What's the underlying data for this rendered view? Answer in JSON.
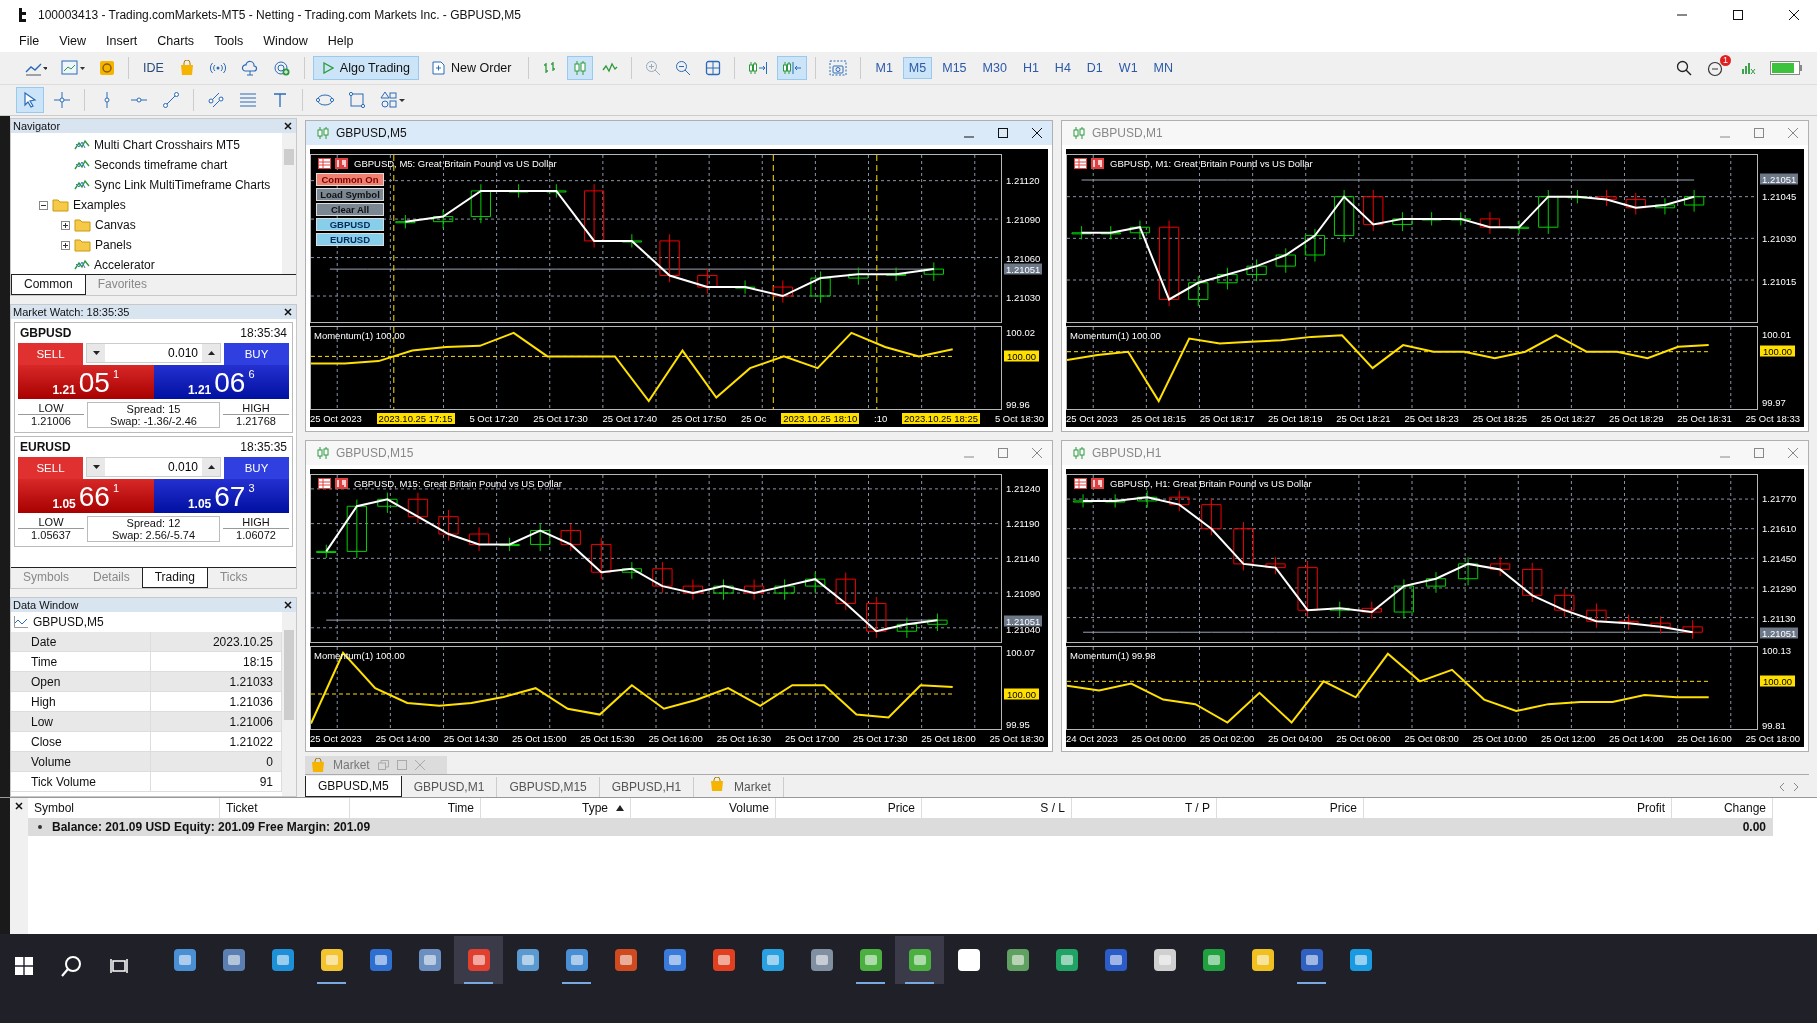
{
  "window": {
    "title": "100003413 - Trading.comMarkets-MT5 - Netting - Trading.com Markets Inc. - GBPUSD,M5"
  },
  "menu": [
    "File",
    "View",
    "Insert",
    "Charts",
    "Tools",
    "Window",
    "Help"
  ],
  "toolbar": {
    "ide": "IDE",
    "algo_trading": {
      "label": "Algo Trading",
      "selected": true
    },
    "new_order": "New Order",
    "chart_modes": [
      {
        "selected": false
      },
      {
        "selected": true
      },
      {
        "selected": false
      }
    ],
    "chart_shift": [
      {
        "selected": false
      },
      {
        "selected": true
      }
    ],
    "timeframes": [
      {
        "label": "M1",
        "selected": false
      },
      {
        "label": "M5",
        "selected": true
      },
      {
        "label": "M15",
        "selected": false
      },
      {
        "label": "M30",
        "selected": false
      },
      {
        "label": "H1",
        "selected": false
      },
      {
        "label": "H4",
        "selected": false
      },
      {
        "label": "D1",
        "selected": false
      },
      {
        "label": "W1",
        "selected": false
      },
      {
        "label": "MN",
        "selected": false
      }
    ],
    "notifications": "1",
    "drawing_tools": [
      {
        "selected": true
      },
      {
        "selected": false
      },
      {
        "selected": false
      },
      {
        "selected": false
      },
      {
        "selected": false
      },
      {
        "selected": false
      },
      {
        "selected": false
      },
      {
        "selected": false
      },
      {
        "selected": false
      },
      {
        "selected": false
      },
      {
        "selected": false
      }
    ]
  },
  "navigator": {
    "title": "Navigator",
    "items": [
      {
        "label": "Multi Chart Crosshairs MT5",
        "kind": "program"
      },
      {
        "label": "Seconds timeframe chart",
        "kind": "program"
      },
      {
        "label": "Sync Link MultiTimeframe Charts",
        "kind": "program"
      },
      {
        "label": "Examples",
        "kind": "folder",
        "expanded": true,
        "children": [
          {
            "label": "Canvas",
            "kind": "folder",
            "expanded": false
          },
          {
            "label": "Panels",
            "kind": "folder",
            "expanded": false
          },
          {
            "label": "Accelerator",
            "kind": "program"
          }
        ]
      }
    ],
    "tabs": [
      {
        "label": "Common",
        "selected": true
      },
      {
        "label": "Favorites",
        "selected": false
      }
    ]
  },
  "market_watch": {
    "title": "Market Watch: 18:35:35",
    "symbols": [
      {
        "symbol": "GBPUSD",
        "time": "18:35:34",
        "sell": "SELL",
        "buy": "BUY",
        "volume": "0.010",
        "bid": {
          "prefix": "1.21",
          "pips": "05",
          "point": "1"
        },
        "ask": {
          "prefix": "1.21",
          "pips": "06",
          "point": "6"
        },
        "low_label": "LOW",
        "low": "1.21006",
        "spread": "Spread: 15",
        "swap": "Swap: -1.36/-2.46",
        "high_label": "HIGH",
        "high": "1.21768"
      },
      {
        "symbol": "EURUSD",
        "time": "18:35:35",
        "sell": "SELL",
        "buy": "BUY",
        "volume": "0.010",
        "bid": {
          "prefix": "1.05",
          "pips": "66",
          "point": "1"
        },
        "ask": {
          "prefix": "1.05",
          "pips": "67",
          "point": "3"
        },
        "low_label": "LOW",
        "low": "1.05637",
        "spread": "Spread: 12",
        "swap": "Swap: 2.56/-5.74",
        "high_label": "HIGH",
        "high": "1.06072"
      }
    ],
    "tabs": [
      {
        "label": "Symbols",
        "selected": false
      },
      {
        "label": "Details",
        "selected": false
      },
      {
        "label": "Trading",
        "selected": true
      },
      {
        "label": "Ticks",
        "selected": false
      }
    ]
  },
  "data_window": {
    "title": "Data Window",
    "symbol": "GBPUSD,M5",
    "rows": [
      {
        "label": "Date",
        "value": "2023.10.25"
      },
      {
        "label": "Time",
        "value": "18:15"
      },
      {
        "label": "Open",
        "value": "1.21033"
      },
      {
        "label": "High",
        "value": "1.21036"
      },
      {
        "label": "Low",
        "value": "1.21006"
      },
      {
        "label": "Close",
        "value": "1.21022"
      },
      {
        "label": "Volume",
        "value": "0"
      },
      {
        "label": "Tick Volume",
        "value": "91"
      }
    ]
  },
  "charts": [
    {
      "title": "GBPUSD,M5",
      "active": true,
      "current_price": "1.21051",
      "indicator_level": "100.00",
      "price_chart": {
        "chart_data": {
          "type": "line",
          "title": "GBPUSD, M5:  Great Britain Pound vs US Dollar",
          "ylim": [
            1.2101,
            1.2114
          ],
          "grid": true,
          "yticks": [
            {
              "value": 1.2112,
              "label": "1.21120"
            },
            {
              "value": 1.2109,
              "label": "1.21090"
            },
            {
              "value": 1.2106,
              "label": "1.21060"
            },
            {
              "value": 1.2103,
              "label": "1.21030"
            }
          ],
          "series": [
            {
              "color": "#ffffff",
              "values": [
                null,
                null,
                1.21088,
                1.21092,
                1.21112,
                1.21112,
                1.21112,
                1.21073,
                1.21073,
                1.21046,
                1.21037,
                1.21037,
                1.2103,
                1.21044,
                1.21047,
                1.21047,
                1.21051
              ]
            },
            {
              "color": "#9aa3b5",
              "values": [
                1.21051,
                1.21051,
                1.21051,
                1.21051,
                1.21051,
                1.21051,
                1.21051,
                1.21051,
                1.21051,
                1.21051,
                1.21051,
                1.21051,
                1.21051,
                1.21051,
                1.21051,
                1.21051,
                1.21051
              ]
            }
          ]
        }
      },
      "momentum_chart": {
        "chart_data": {
          "type": "line",
          "title": "Momentum(1) 100.00",
          "ylim": [
            99.955,
            100.025
          ],
          "grid": true,
          "yticks": [
            {
              "value": 100.02,
              "label": "100.02"
            },
            {
              "value": 99.96,
              "label": "99.96"
            }
          ],
          "series": [
            {
              "color": "#ffe000",
              "values": [
                99.994,
                99.994,
                99.996,
                100.005,
                100.008,
                100.009,
                100.02,
                100.0,
                100.0,
                100.0,
                99.962,
                100.005,
                99.965,
                99.99,
                100.0,
                99.99,
                100.02,
                100.008,
                100.0,
                100.006
              ]
            },
            {
              "color": "#ffe000",
              "line_style": "dashed",
              "values": [
                100.0,
                100.0,
                100.0,
                100.0,
                100.0,
                100.0,
                100.0,
                100.0,
                100.0,
                100.0,
                100.0,
                100.0,
                100.0,
                100.0,
                100.0,
                100.0,
                100.0,
                100.0,
                100.0,
                100.0
              ]
            }
          ]
        }
      },
      "panel_buttons": [
        {
          "label": "Common On",
          "kind": "toggle"
        },
        {
          "label": "Load Symbol",
          "kind": "action"
        },
        {
          "label": "Clear All",
          "kind": "action"
        },
        {
          "label": "GBPUSD",
          "kind": "symbol"
        },
        {
          "label": "EURUSD",
          "kind": "symbol"
        }
      ],
      "time_labels": [
        {
          "text": "25 Oct 2023",
          "kind": "time"
        },
        {
          "text": "2023.10.25 17:15",
          "kind": "marker"
        },
        {
          "text": "5 Oct 17:20",
          "kind": "time"
        },
        {
          "text": "25 Oct 17:30",
          "kind": "time"
        },
        {
          "text": "25 Oct 17:40",
          "kind": "time"
        },
        {
          "text": "25 Oct 17:50",
          "kind": "time"
        },
        {
          "text": "25 Oc",
          "kind": "time"
        },
        {
          "text": "2023.10.25 18:10",
          "kind": "marker"
        },
        {
          "text": ":10",
          "kind": "time"
        },
        {
          "text": "2023.10.25 18:25",
          "kind": "marker"
        },
        {
          "text": "5 Oct 18:30",
          "kind": "time"
        }
      ]
    },
    {
      "title": "GBPUSD,M1",
      "active": false,
      "current_price": "1.21051",
      "indicator_level": "100.00",
      "price_chart": {
        "chart_data": {
          "type": "line",
          "title": "GBPUSD, M1:  Great Britain Pound vs US Dollar",
          "ylim": [
            1.21,
            1.2106
          ],
          "grid": true,
          "yticks": [
            {
              "value": 1.21045,
              "label": "1.21045"
            },
            {
              "value": 1.2103,
              "label": "1.21030"
            },
            {
              "value": 1.21015,
              "label": "1.21015"
            }
          ],
          "series": [
            {
              "color": "#ffffff",
              "values": [
                1.21032,
                1.21032,
                1.21034,
                1.21008,
                1.21014,
                1.21017,
                1.2102,
                1.21024,
                1.21031,
                1.21045,
                1.21035,
                1.21037,
                1.21037,
                1.21037,
                1.21034,
                1.21034,
                1.21045,
                1.21045,
                1.21044,
                1.21041,
                1.21042,
                1.21045
              ]
            },
            {
              "color": "#9aa3b5",
              "values": [
                1.21051,
                1.21051,
                1.21051,
                1.21051,
                1.21051,
                1.21051,
                1.21051,
                1.21051,
                1.21051,
                1.21051,
                1.21051,
                1.21051,
                1.21051,
                1.21051,
                1.21051,
                1.21051,
                1.21051,
                1.21051,
                1.21051,
                1.21051,
                1.21051,
                1.21051
              ]
            }
          ]
        }
      },
      "momentum_chart": {
        "chart_data": {
          "type": "line",
          "title": "Momentum(1) 100.00",
          "ylim": [
            99.965,
            100.015
          ],
          "grid": true,
          "yticks": [
            {
              "value": 100.01,
              "label": "100.01"
            },
            {
              "value": 99.97,
              "label": "99.97"
            }
          ],
          "series": [
            {
              "color": "#ffe000",
              "values": [
                99.995,
                99.998,
                100.0,
                99.97,
                100.008,
                100.005,
                100.006,
                100.007,
                100.009,
                100.01,
                99.99,
                100.004,
                100.0,
                100.0,
                99.996,
                100.0,
                100.01,
                100.0,
                100.0,
                99.996,
                100.003,
                100.004
              ]
            },
            {
              "color": "#ffe000",
              "line_style": "dashed",
              "values": [
                100.0,
                100.0,
                100.0,
                100.0,
                100.0,
                100.0,
                100.0,
                100.0,
                100.0,
                100.0,
                100.0,
                100.0,
                100.0,
                100.0,
                100.0,
                100.0,
                100.0,
                100.0,
                100.0,
                100.0,
                100.0,
                100.0
              ]
            }
          ]
        }
      },
      "time_labels": [
        {
          "text": "25 Oct 2023",
          "kind": "time"
        },
        {
          "text": "25 Oct 18:15",
          "kind": "time"
        },
        {
          "text": "25 Oct 18:17",
          "kind": "time"
        },
        {
          "text": "25 Oct 18:19",
          "kind": "time"
        },
        {
          "text": "25 Oct 18:21",
          "kind": "time"
        },
        {
          "text": "25 Oct 18:23",
          "kind": "time"
        },
        {
          "text": "25 Oct 18:25",
          "kind": "time"
        },
        {
          "text": "25 Oct 18:27",
          "kind": "time"
        },
        {
          "text": "25 Oct 18:29",
          "kind": "time"
        },
        {
          "text": "25 Oct 18:31",
          "kind": "time"
        },
        {
          "text": "25 Oct 18:33",
          "kind": "time"
        }
      ]
    },
    {
      "title": "GBPUSD,M15",
      "active": false,
      "current_price": "1.21051",
      "indicator_level": "100.00",
      "price_chart": {
        "chart_data": {
          "type": "line",
          "title": "GBPUSD, M15:  Great Britain Pound vs US Dollar",
          "ylim": [
            1.2102,
            1.2126
          ],
          "grid": true,
          "yticks": [
            {
              "value": 1.2124,
              "label": "1.21240"
            },
            {
              "value": 1.2119,
              "label": "1.21190"
            },
            {
              "value": 1.2114,
              "label": "1.21140"
            },
            {
              "value": 1.2109,
              "label": "1.21090"
            },
            {
              "value": 1.2104,
              "label": "1.21040"
            }
          ],
          "series": [
            {
              "color": "#ffffff",
              "values": [
                1.2115,
                1.21215,
                1.21225,
                1.212,
                1.21175,
                1.2116,
                1.2116,
                1.2118,
                1.2116,
                1.2112,
                1.21125,
                1.211,
                1.2109,
                1.211,
                1.2109,
                1.211,
                1.2111,
                1.21075,
                1.21035,
                1.21045,
                1.21051
              ]
            },
            {
              "color": "#9aa3b5",
              "values": [
                1.21051,
                1.21051,
                1.21051,
                1.21051,
                1.21051,
                1.21051,
                1.21051,
                1.21051,
                1.21051,
                1.21051,
                1.21051,
                1.21051,
                1.21051,
                1.21051,
                1.21051,
                1.21051,
                1.21051,
                1.21051,
                1.21051,
                1.21051,
                1.21051
              ]
            }
          ]
        }
      },
      "momentum_chart": {
        "chart_data": {
          "type": "line",
          "title": "Momentum(1) 100.00",
          "ylim": [
            99.94,
            100.08
          ],
          "grid": true,
          "yticks": [
            {
              "value": 100.07,
              "label": "100.07"
            },
            {
              "value": 99.95,
              "label": "99.95"
            }
          ],
          "series": [
            {
              "color": "#ffe000",
              "values": [
                99.95,
                100.07,
                100.01,
                99.985,
                99.98,
                99.985,
                99.995,
                100.01,
                99.975,
                99.965,
                100.015,
                99.975,
                99.99,
                100.01,
                99.98,
                100.015,
                100.015,
                99.965,
                99.96,
                100.015,
                100.012
              ]
            },
            {
              "color": "#ffe000",
              "line_style": "dashed",
              "values": [
                100.0,
                100.0,
                100.0,
                100.0,
                100.0,
                100.0,
                100.0,
                100.0,
                100.0,
                100.0,
                100.0,
                100.0,
                100.0,
                100.0,
                100.0,
                100.0,
                100.0,
                100.0,
                100.0,
                100.0,
                100.0
              ]
            }
          ]
        }
      },
      "time_labels": [
        {
          "text": "25 Oct 2023",
          "kind": "time"
        },
        {
          "text": "25 Oct 14:00",
          "kind": "time"
        },
        {
          "text": "25 Oct 14:30",
          "kind": "time"
        },
        {
          "text": "25 Oct 15:00",
          "kind": "time"
        },
        {
          "text": "25 Oct 15:30",
          "kind": "time"
        },
        {
          "text": "25 Oct 16:00",
          "kind": "time"
        },
        {
          "text": "25 Oct 16:30",
          "kind": "time"
        },
        {
          "text": "25 Oct 17:00",
          "kind": "time"
        },
        {
          "text": "25 Oct 17:30",
          "kind": "time"
        },
        {
          "text": "25 Oct 18:00",
          "kind": "time"
        },
        {
          "text": "25 Oct 18:30",
          "kind": "time"
        }
      ]
    },
    {
      "title": "GBPUSD,H1",
      "active": false,
      "current_price": "1.21051",
      "indicator_level": "100.00",
      "price_chart": {
        "chart_data": {
          "type": "line",
          "title": "GBPUSD, H1:  Great Britain Pound vs US Dollar",
          "ylim": [
            1.21,
            1.219
          ],
          "grid": true,
          "yticks": [
            {
              "value": 1.2177,
              "label": "1.21770"
            },
            {
              "value": 1.2161,
              "label": "1.21610"
            },
            {
              "value": 1.2145,
              "label": "1.21450"
            },
            {
              "value": 1.2129,
              "label": "1.21290"
            },
            {
              "value": 1.2113,
              "label": "1.21130"
            }
          ],
          "series": [
            {
              "color": "#ffffff",
              "values": [
                1.2176,
                1.2176,
                1.2178,
                1.2174,
                1.2161,
                1.2142,
                1.214,
                1.2117,
                1.2118,
                1.2116,
                1.213,
                1.2134,
                1.2142,
                1.2139,
                1.2125,
                1.2117,
                1.2111,
                1.211,
                1.2108,
                1.21051
              ]
            },
            {
              "color": "#9aa3b5",
              "values": [
                1.21051,
                1.21051,
                1.21051,
                1.21051,
                1.21051,
                1.21051,
                1.21051,
                1.21051,
                1.21051,
                1.21051,
                1.21051,
                1.21051,
                1.21051,
                1.21051,
                1.21051,
                1.21051,
                1.21051,
                1.21051,
                1.21051,
                1.21051
              ]
            }
          ]
        }
      },
      "momentum_chart": {
        "chart_data": {
          "type": "line",
          "title": "Momentum(1) 99.98",
          "ylim": [
            99.79,
            100.15
          ],
          "grid": true,
          "yticks": [
            {
              "value": 100.13,
              "label": "100.13"
            },
            {
              "value": 99.81,
              "label": "99.81"
            }
          ],
          "series": [
            {
              "color": "#ffe000",
              "values": [
                99.98,
                99.96,
                99.99,
                99.92,
                99.9,
                99.82,
                99.95,
                99.82,
                100.0,
                99.93,
                100.12,
                100.0,
                100.05,
                99.92,
                99.87,
                99.9,
                99.91,
                99.91,
                99.94,
                99.93,
                99.93
              ]
            },
            {
              "color": "#ffe000",
              "line_style": "dashed",
              "values": [
                100.0,
                100.0,
                100.0,
                100.0,
                100.0,
                100.0,
                100.0,
                100.0,
                100.0,
                100.0,
                100.0,
                100.0,
                100.0,
                100.0,
                100.0,
                100.0,
                100.0,
                100.0,
                100.0,
                100.0,
                100.0
              ]
            }
          ]
        }
      },
      "time_labels": [
        {
          "text": "24 Oct 2023",
          "kind": "time"
        },
        {
          "text": "25 Oct 00:00",
          "kind": "time"
        },
        {
          "text": "25 Oct 02:00",
          "kind": "time"
        },
        {
          "text": "25 Oct 04:00",
          "kind": "time"
        },
        {
          "text": "25 Oct 06:00",
          "kind": "time"
        },
        {
          "text": "25 Oct 08:00",
          "kind": "time"
        },
        {
          "text": "25 Oct 10:00",
          "kind": "time"
        },
        {
          "text": "25 Oct 12:00",
          "kind": "time"
        },
        {
          "text": "25 Oct 14:00",
          "kind": "time"
        },
        {
          "text": "25 Oct 16:00",
          "kind": "time"
        },
        {
          "text": "25 Oct 18:00",
          "kind": "time"
        }
      ]
    }
  ],
  "minimized_window": {
    "title": "Market"
  },
  "chart_tabs": [
    {
      "label": "GBPUSD,M5",
      "kind": "chart",
      "selected": true
    },
    {
      "label": "GBPUSD,M1",
      "kind": "chart",
      "selected": false
    },
    {
      "label": "GBPUSD,M15",
      "kind": "chart",
      "selected": false
    },
    {
      "label": "GBPUSD,H1",
      "kind": "chart",
      "selected": false
    },
    {
      "label": "Market",
      "kind": "market",
      "selected": false
    }
  ],
  "toolbox": {
    "columns": [
      {
        "label": "Symbol",
        "sorted": false
      },
      {
        "label": "Ticket",
        "sorted": false
      },
      {
        "label": "Time",
        "sorted": false
      },
      {
        "label": "Type",
        "sorted": true
      },
      {
        "label": "Volume",
        "sorted": false
      },
      {
        "label": "Price",
        "sorted": false
      },
      {
        "label": "S / L",
        "sorted": false
      },
      {
        "label": "T / P",
        "sorted": false
      },
      {
        "label": "Price",
        "sorted": false
      },
      {
        "label": "Profit",
        "sorted": false
      },
      {
        "label": "Change",
        "sorted": false
      }
    ],
    "balance": "Balance: 201.09 USD  Equity: 201.09  Free Margin: 201.09",
    "profit": "0.00"
  },
  "taskbar": {
    "apps": [
      {
        "running": false,
        "selected": false
      },
      {
        "running": false,
        "selected": false
      },
      {
        "running": false,
        "selected": false
      },
      {
        "running": true,
        "selected": false
      },
      {
        "running": false,
        "selected": false
      },
      {
        "running": false,
        "selected": false
      },
      {
        "running": true,
        "selected": true
      },
      {
        "running": false,
        "selected": false
      },
      {
        "running": true,
        "selected": false
      },
      {
        "running": false,
        "selected": false
      },
      {
        "running": false,
        "selected": false
      },
      {
        "running": false,
        "selected": false
      },
      {
        "running": false,
        "selected": false
      },
      {
        "running": false,
        "selected": false
      },
      {
        "running": true,
        "selected": false
      },
      {
        "running": true,
        "selected": true
      },
      {
        "running": false,
        "selected": false
      },
      {
        "running": false,
        "selected": false
      },
      {
        "running": false,
        "selected": false
      },
      {
        "running": false,
        "selected": false
      },
      {
        "running": false,
        "selected": false
      },
      {
        "running": false,
        "selected": false
      },
      {
        "running": false,
        "selected": false
      },
      {
        "running": true,
        "selected": false
      },
      {
        "running": false,
        "selected": false
      }
    ]
  }
}
